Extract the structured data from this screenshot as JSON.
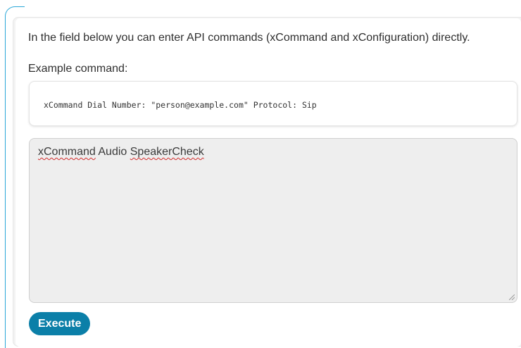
{
  "description": "In the field below you can enter API commands (xCommand and xConfiguration) directly.",
  "example_label": "Example command:",
  "example_command": "xCommand Dial Number: \"person@example.com\" Protocol: Sip",
  "command_input": {
    "words": [
      "xCommand",
      "Audio",
      "SpeakerCheck"
    ]
  },
  "execute_label": "Execute",
  "colors": {
    "accent": "#0b7fa8",
    "focus_outline": "#2aa7d8",
    "spellcheck": "#d12b2b"
  }
}
